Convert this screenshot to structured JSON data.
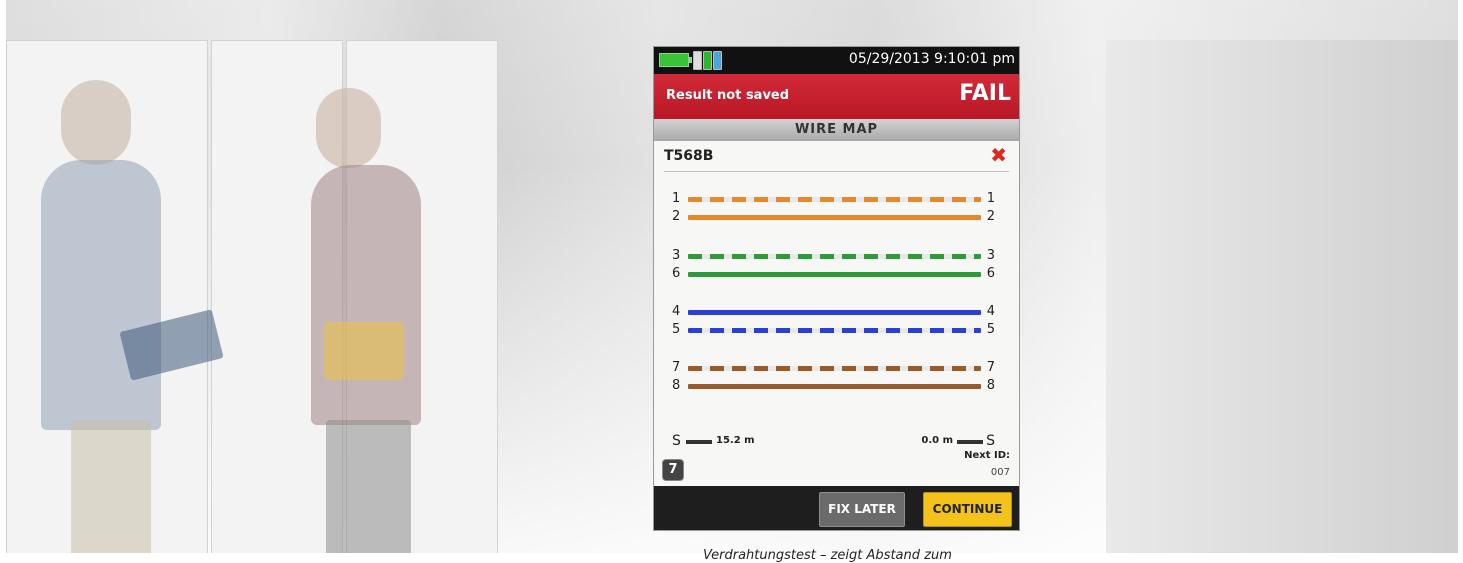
{
  "device": {
    "status_bar": {
      "datetime": "05/29/2013 9:10:01 pm",
      "battery_icon": "battery-icon",
      "indicator_icons": [
        "battery-cells-icon"
      ]
    },
    "result": {
      "message": "Result not saved",
      "verdict": "FAIL",
      "verdict_color": "#c41e2e"
    },
    "screen_title": "WIRE MAP",
    "standard": {
      "name": "T568B",
      "status_icon": "red-x-icon"
    },
    "wires": [
      {
        "left": "1",
        "right": "1",
        "color": "#e8882a",
        "striped": true
      },
      {
        "left": "2",
        "right": "2",
        "color": "#e8882a",
        "striped": false
      },
      {
        "left": "3",
        "right": "3",
        "color": "#2e9a3a",
        "striped": true
      },
      {
        "left": "6",
        "right": "6",
        "color": "#2e9a3a",
        "striped": false
      },
      {
        "left": "4",
        "right": "4",
        "color": "#2a3fd6",
        "striped": false
      },
      {
        "left": "5",
        "right": "5",
        "color": "#2a3fd6",
        "striped": true
      },
      {
        "left": "7",
        "right": "7",
        "color": "#9a5a2a",
        "striped": true
      },
      {
        "left": "8",
        "right": "8",
        "color": "#9a5a2a",
        "striped": false
      }
    ],
    "shield": {
      "left_label": "S",
      "right_label": "S",
      "left_distance": "15.2 m",
      "right_distance": "0.0 m"
    },
    "badge": "7",
    "next_id": {
      "label": "Next ID:",
      "value": "007"
    },
    "buttons": {
      "fix_later": "FIX LATER",
      "continue": "CONTINUE"
    }
  },
  "caption": "Verdrahtungstest – zeigt Abstand zum"
}
